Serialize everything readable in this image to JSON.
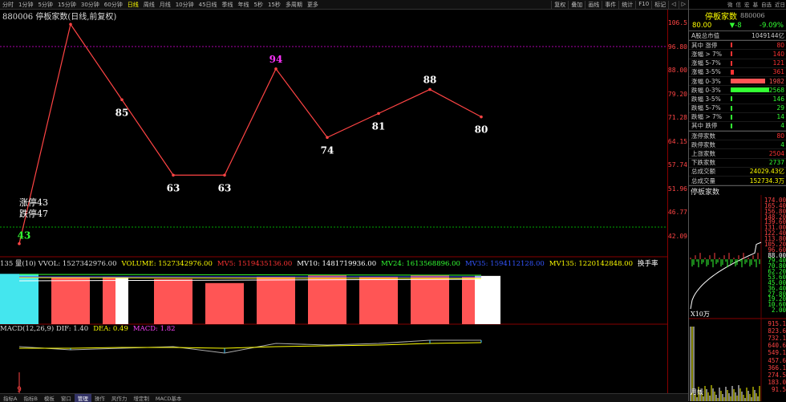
{
  "topbar": {
    "timeframes": [
      "分时",
      "1分钟",
      "5分钟",
      "15分钟",
      "30分钟",
      "60分钟",
      "日线",
      "周线",
      "月线",
      "10分钟",
      "45日线",
      "季线",
      "年线",
      "5秒",
      "15秒",
      "多周期",
      "更多"
    ],
    "active_index": 6,
    "right_items": [
      "复权",
      "叠加",
      "画线",
      "事件",
      "统计",
      "F10",
      "标记",
      "◁",
      "▷"
    ]
  },
  "chart": {
    "title": "880006 停板家数(日线,前复权)",
    "line_color": "#ff4444",
    "points": [
      {
        "label": "43",
        "value": 43
      },
      {
        "label": "",
        "value": 107
      },
      {
        "label": "85",
        "value": 85
      },
      {
        "label": "63",
        "value": 63
      },
      {
        "label": "63",
        "value": 63
      },
      {
        "label": "94",
        "value": 94
      },
      {
        "label": "74",
        "value": 74
      },
      {
        "label": "81",
        "value": 81
      },
      {
        "label": "88",
        "value": 88
      },
      {
        "label": "80",
        "value": 80
      }
    ],
    "legend": [
      "涨停43",
      "跌停47"
    ],
    "y_ticks": [
      "106.5",
      "96.80",
      "88.00",
      "79.20",
      "71.28",
      "64.15",
      "57.74",
      "51.96",
      "46.77",
      "42.09"
    ]
  },
  "volume": {
    "header": [
      {
        "text": "135 量(10) VVOL: 1527342976.00",
        "color": "#dddddd"
      },
      {
        "text": "VOLUME: 1527342976.00",
        "color": "#ffff00"
      },
      {
        "text": "MV5: 1519435136.00",
        "color": "#ff3333"
      },
      {
        "text": "MV10: 1481719936.00",
        "color": "#ffffff"
      },
      {
        "text": "MV24: 1613568896.00",
        "color": "#33ff33"
      },
      {
        "text": "MV35: 1594112128.00",
        "color": "#3355ff"
      },
      {
        "text": "MV135: 1220142848.00",
        "color": "#ffff00"
      },
      {
        "text": "换手率",
        "color": "#ffffff"
      }
    ],
    "bars": [
      {
        "v": 0.98,
        "c": "#44e6ee"
      },
      {
        "v": 0.92,
        "c": "#ff5555"
      },
      {
        "v": 0.93,
        "c": "#ff5555"
      },
      {
        "v": 0.91,
        "c": "#ffffff"
      },
      {
        "v": 0.88,
        "c": "#ff5555"
      },
      {
        "v": 0.8,
        "c": "#ff5555"
      },
      {
        "v": 0.92,
        "c": "#ff5555"
      },
      {
        "v": 0.95,
        "c": "#ff5555"
      },
      {
        "v": 0.93,
        "c": "#ff5555"
      },
      {
        "v": 0.95,
        "c": "#ff5555"
      },
      {
        "v": 0.93,
        "c": "#ff5555"
      },
      {
        "v": 0.94,
        "c": "#ffffff"
      }
    ]
  },
  "macd": {
    "header": [
      {
        "text": "MACD(12,26,9) DIF: 1.40",
        "color": "#dddddd"
      },
      {
        "text": "DEA: 0.49",
        "color": "#ffff00"
      },
      {
        "text": "MACD: 1.82",
        "color": "#ff44ff"
      }
    ],
    "bottom_label": "9"
  },
  "bottombar": {
    "tabs": [
      "指标A",
      "指标B",
      "模板",
      "窗口",
      "管理",
      "操作",
      "风作力",
      "增定制",
      "MACD基本"
    ],
    "active_index": 4
  },
  "panel": {
    "top_items": [
      "微",
      "信",
      "宏",
      "基",
      "自选",
      "近日"
    ],
    "name": "停板家数",
    "code": "880006",
    "price": "80.00",
    "change": "▼-8",
    "change_pct": "-9.09%",
    "market_cap": {
      "label": "A股总市值",
      "value": "1049144亿"
    },
    "dist": [
      {
        "label": "其中 涨停",
        "value": "80",
        "bar": 0.02,
        "c": "#ff3333"
      },
      {
        "label": "涨幅 > 7%",
        "value": "140",
        "bar": 0.03,
        "c": "#ff3333"
      },
      {
        "label": "涨幅 5-7%",
        "value": "121",
        "bar": 0.03,
        "c": "#ff3333"
      },
      {
        "label": "涨幅 3-5%",
        "value": "361",
        "bar": 0.08,
        "c": "#ff3333"
      },
      {
        "label": "涨幅 0-3%",
        "value": "1982",
        "bar": 0.9,
        "c": "#ff5555"
      },
      {
        "label": "跌幅 0-3%",
        "value": "2568",
        "bar": 1.0,
        "c": "#33ff33"
      },
      {
        "label": "跌幅 3-5%",
        "value": "146",
        "bar": 0.03,
        "c": "#33ff33"
      },
      {
        "label": "跌幅 5-7%",
        "value": "29",
        "bar": 0.01,
        "c": "#33ff33"
      },
      {
        "label": "跌幅 > 7%",
        "value": "14",
        "bar": 0.01,
        "c": "#33ff33"
      },
      {
        "label": "其中 跌停",
        "value": "4",
        "bar": 0.01,
        "c": "#33ff33"
      }
    ],
    "stats": [
      {
        "label": "涨停家数",
        "value": "80",
        "c": "#ff3333"
      },
      {
        "label": "跌停家数",
        "value": "4",
        "c": "#33ff33"
      },
      {
        "label": "上涨家数",
        "value": "2504",
        "c": "#ff3333"
      },
      {
        "label": "下跌家数",
        "value": "2737",
        "c": "#33ff33"
      },
      {
        "label": "总成交额",
        "value": "24029.43亿",
        "c": "#ffff00"
      },
      {
        "label": "总成交量",
        "value": "152734.3万",
        "c": "#ffff00"
      }
    ],
    "mini_title": "停板家数",
    "mini_ticks_top": [
      {
        "t": "174.00",
        "c": "#ff4444"
      },
      {
        "t": "165.40",
        "c": "#ff4444"
      },
      {
        "t": "156.80",
        "c": "#ff4444"
      },
      {
        "t": "148.20",
        "c": "#ff4444"
      },
      {
        "t": "139.60",
        "c": "#ff4444"
      },
      {
        "t": "131.00",
        "c": "#ff4444"
      },
      {
        "t": "122.40",
        "c": "#ff4444"
      },
      {
        "t": "113.80",
        "c": "#ff4444"
      },
      {
        "t": "105.20",
        "c": "#ff4444"
      },
      {
        "t": "96.60",
        "c": "#ff4444"
      },
      {
        "t": "88.00",
        "c": "#ffffff"
      },
      {
        "t": "79.40",
        "c": "#33ff33"
      },
      {
        "t": "70.80",
        "c": "#33ff33"
      },
      {
        "t": "62.20",
        "c": "#33ff33"
      },
      {
        "t": "53.60",
        "c": "#33ff33"
      },
      {
        "t": "45.00",
        "c": "#33ff33"
      },
      {
        "t": "36.40",
        "c": "#33ff33"
      },
      {
        "t": "27.80",
        "c": "#33ff33"
      },
      {
        "t": "19.20",
        "c": "#33ff33"
      },
      {
        "t": "10.60",
        "c": "#33ff33"
      },
      {
        "t": "2.00",
        "c": "#33ff33"
      }
    ],
    "mini_ticks_bottom": [
      "915.1",
      "823.6",
      "732.1",
      "640.6",
      "549.1",
      "457.6",
      "366.1",
      "274.5",
      "183.0",
      "91.5"
    ],
    "mini_label": "X10万",
    "mini_label2": "月线"
  }
}
